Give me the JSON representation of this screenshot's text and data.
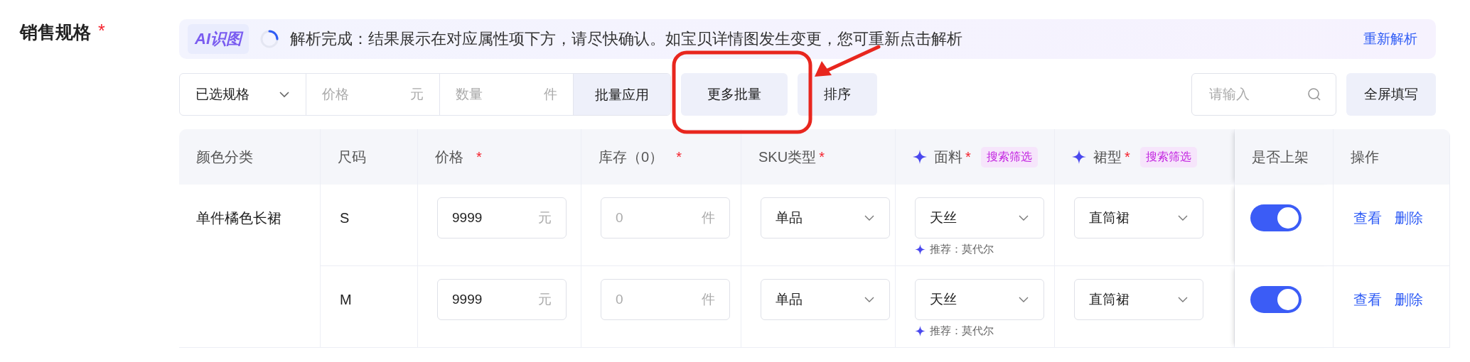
{
  "section": {
    "label": "销售规格",
    "required_mark": "*"
  },
  "ai_bar": {
    "badge": "AI识图",
    "message": "解析完成：结果展示在对应属性项下方，请尽快确认。如宝贝详情图发生变更，您可重新点击解析",
    "action": "重新解析"
  },
  "toolbar": {
    "spec_select": "已选规格",
    "price": {
      "placeholder": "价格",
      "unit": "元"
    },
    "quantity": {
      "placeholder": "数量",
      "unit": "件"
    },
    "buttons": [
      "批量应用",
      "更多批量",
      "排序"
    ],
    "search": {
      "placeholder": "请输入"
    },
    "fullscreen": "全屏填写"
  },
  "table": {
    "columns": [
      {
        "label": "颜色分类",
        "ai": false
      },
      {
        "label": "尺码",
        "ai": false
      },
      {
        "label": "价格",
        "required_mark": "*",
        "ai": false
      },
      {
        "label": "库存（0）",
        "required_mark": "*",
        "ai": false
      },
      {
        "label": "SKU类型",
        "required_mark": "*",
        "ai": false
      },
      {
        "label": "面料",
        "required_mark": "*",
        "ai": true,
        "tag": "搜索筛选"
      },
      {
        "label": "裙型",
        "required_mark": "*",
        "ai": true,
        "tag": "搜索筛选"
      },
      {
        "label": "是否上架",
        "ai": false
      },
      {
        "label": "操作",
        "ai": false
      }
    ],
    "groups": [
      {
        "label": "单件橘色长裙",
        "rows": [
          {
            "size": "S",
            "price": "9999",
            "price_unit": "元",
            "stock_placeholder": "0",
            "stock_unit": "件",
            "sku": "单品",
            "fabric": "天丝",
            "fabric_hint": "推荐：莫代尔",
            "skirt": "直筒裙",
            "on": true,
            "actions": [
              "查看",
              "删除"
            ]
          },
          {
            "size": "M",
            "price": "9999",
            "price_unit": "元",
            "stock_placeholder": "0",
            "stock_unit": "件",
            "sku": "单品",
            "fabric": "天丝",
            "fabric_hint": "推荐：莫代尔",
            "skirt": "直筒裙",
            "on": true,
            "actions": [
              "查看",
              "删除"
            ]
          }
        ]
      }
    ]
  }
}
